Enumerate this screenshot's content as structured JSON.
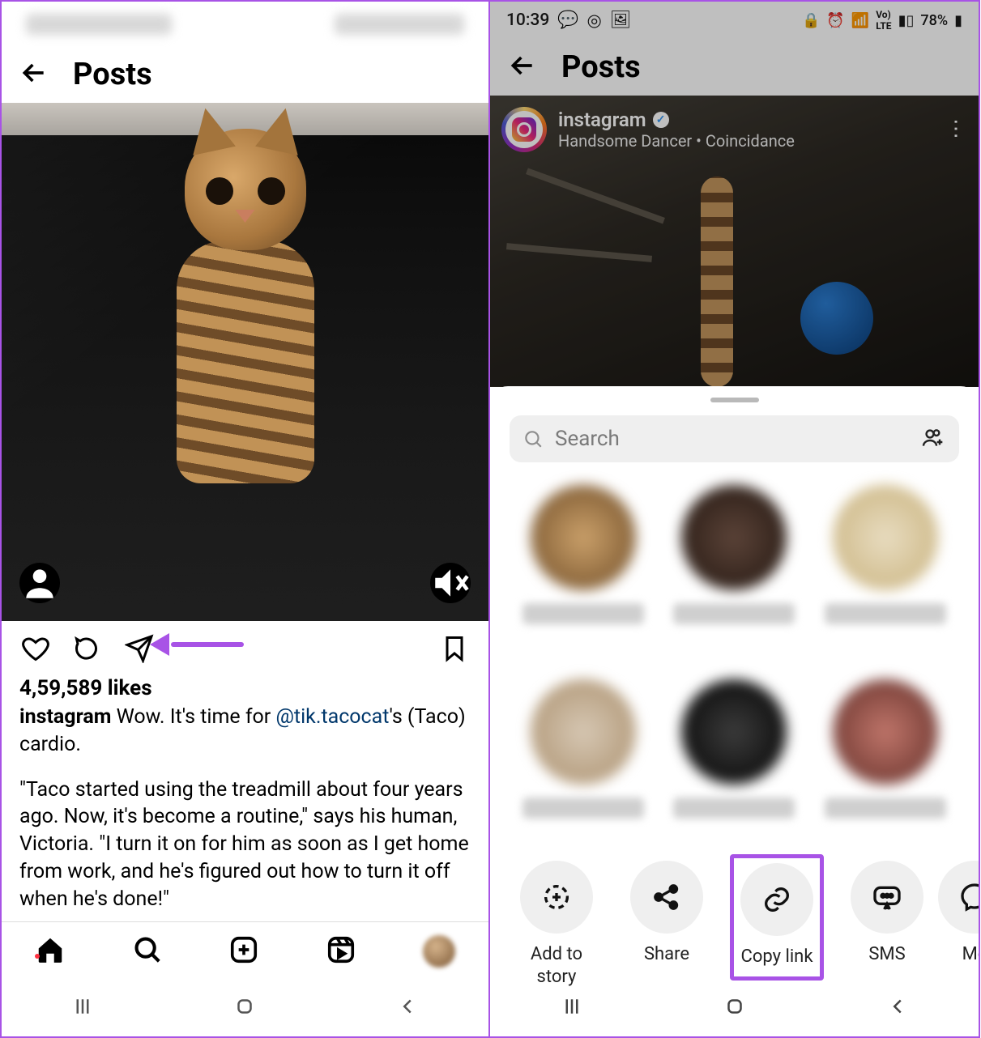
{
  "left": {
    "header": {
      "title": "Posts"
    },
    "post": {
      "likes_text": "4,59,589 likes",
      "username": "instagram",
      "caption_1a": " Wow. It's time for ",
      "mention": "@tik.tacocat",
      "caption_1b": "'s (Taco) cardio.",
      "caption_2": "\"Taco started using the treadmill about four years ago. Now, it's become a routine,\" says his human, Victoria. \"I turn it on for him as soon as I get home from work, and he's figured out how to turn it off when he's done!\""
    }
  },
  "right": {
    "status": {
      "time": "10:39",
      "battery": "78%"
    },
    "header": {
      "title": "Posts"
    },
    "post_header": {
      "username": "instagram",
      "subtitle": "Handsome Dancer • Coincidance"
    },
    "sheet": {
      "search_placeholder": "Search",
      "options": {
        "add_to_story": "Add to story",
        "share": "Share",
        "copy_link": "Copy link",
        "sms": "SMS",
        "messenger": "Me"
      }
    }
  }
}
